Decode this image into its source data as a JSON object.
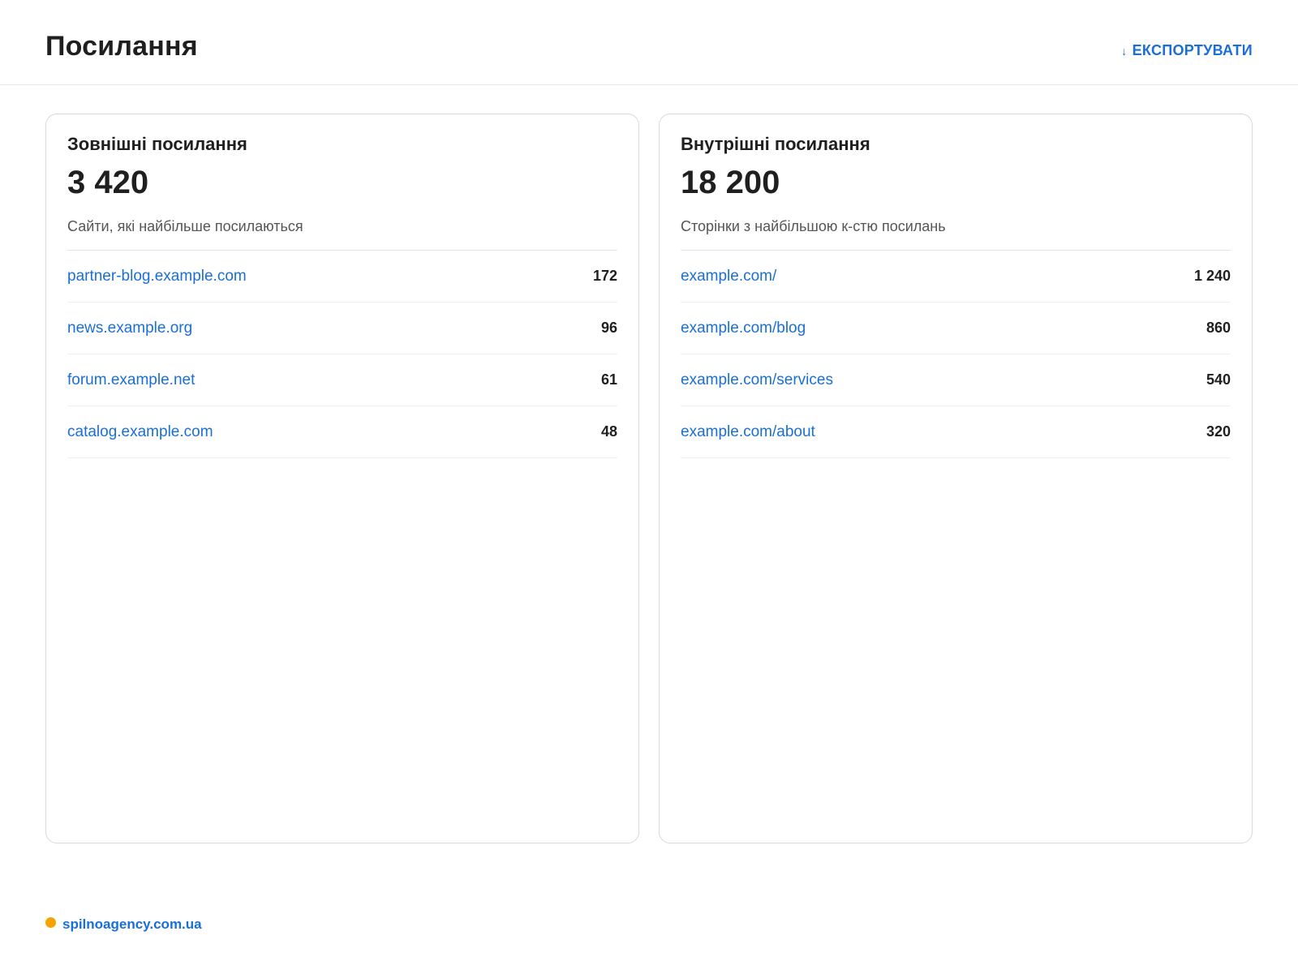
{
  "header": {
    "title": "Посилання",
    "export_label": "ЕКСПОРТУВАТИ",
    "export_icon": "↓"
  },
  "cards": [
    {
      "title": "Зовнішні посилання",
      "total": "3 420",
      "subtitle": "Сайти, які найбільше посилаються",
      "rows": [
        {
          "label": "partner-blog.example.com",
          "count": "172"
        },
        {
          "label": "news.example.org",
          "count": "96"
        },
        {
          "label": "forum.example.net",
          "count": "61"
        },
        {
          "label": "catalog.example.com",
          "count": "48"
        }
      ]
    },
    {
      "title": "Внутрішні посилання",
      "total": "18 200",
      "subtitle": "Сторінки з найбільшою к-стю посилань",
      "rows": [
        {
          "label": "example.com/",
          "count": "1 240"
        },
        {
          "label": "example.com/blog",
          "count": "860"
        },
        {
          "label": "example.com/services",
          "count": "540"
        },
        {
          "label": "example.com/about",
          "count": "320"
        }
      ]
    }
  ],
  "footer": {
    "brand": "spilnoagency.com.ua",
    "dot_color": "#f4a300"
  },
  "colors": {
    "accent": "#1a6fd6",
    "text": "#1f1f1f",
    "muted": "#555555"
  }
}
